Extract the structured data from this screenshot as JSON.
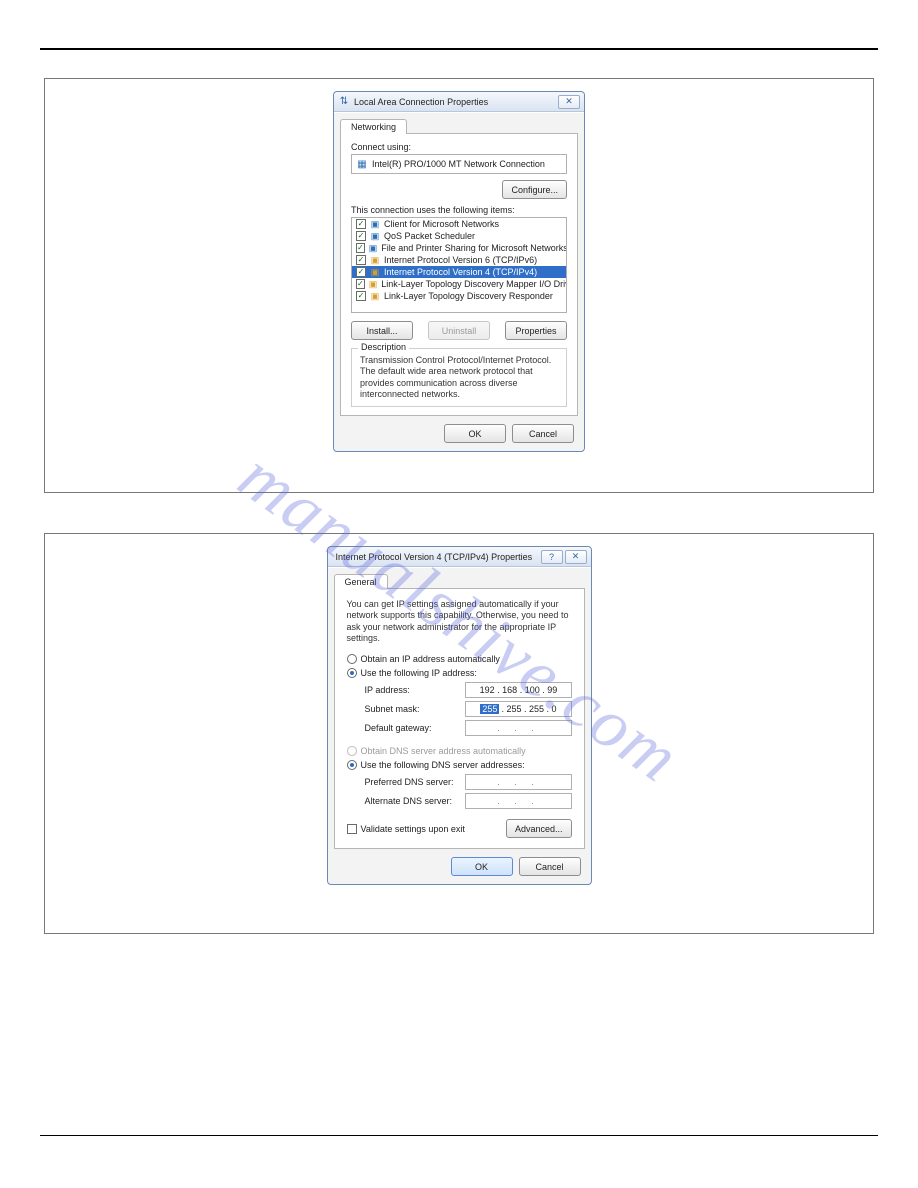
{
  "watermark": "manualshive.com",
  "dialog1": {
    "title": "Local Area Connection Properties",
    "tab": "Networking",
    "connect_using_label": "Connect using:",
    "adapter": "Intel(R) PRO/1000 MT Network Connection",
    "configure": "Configure...",
    "items_label": "This connection uses the following items:",
    "items": [
      {
        "label": "Client for Microsoft Networks",
        "selected": false,
        "iconColor": "#2b6fb5"
      },
      {
        "label": "QoS Packet Scheduler",
        "selected": false,
        "iconColor": "#2b6fb5"
      },
      {
        "label": "File and Printer Sharing for Microsoft Networks",
        "selected": false,
        "iconColor": "#2b6fb5"
      },
      {
        "label": "Internet Protocol Version 6 (TCP/IPv6)",
        "selected": false,
        "iconColor": "#d8a02a"
      },
      {
        "label": "Internet Protocol Version 4 (TCP/IPv4)",
        "selected": true,
        "iconColor": "#d8a02a"
      },
      {
        "label": "Link-Layer Topology Discovery Mapper I/O Driver",
        "selected": false,
        "iconColor": "#d8a02a"
      },
      {
        "label": "Link-Layer Topology Discovery Responder",
        "selected": false,
        "iconColor": "#d8a02a"
      }
    ],
    "install": "Install...",
    "uninstall": "Uninstall",
    "properties": "Properties",
    "desc_title": "Description",
    "desc": "Transmission Control Protocol/Internet Protocol. The default wide area network protocol that provides communication across diverse interconnected networks.",
    "ok": "OK",
    "cancel": "Cancel"
  },
  "dialog2": {
    "title": "Internet Protocol Version 4 (TCP/IPv4) Properties",
    "tab": "General",
    "blurb": "You can get IP settings assigned automatically if your network supports this capability. Otherwise, you need to ask your network administrator for the appropriate IP settings.",
    "opt_auto_ip": "Obtain an IP address automatically",
    "opt_manual_ip": "Use the following IP address:",
    "ip_label": "IP address:",
    "ip_value": "192 . 168 . 100 . 99",
    "subnet_label": "Subnet mask:",
    "subnet_sel": "255",
    "subnet_rest": " . 255 . 255 .  0",
    "gateway_label": "Default gateway:",
    "gateway_value": ".       .       .",
    "opt_auto_dns": "Obtain DNS server address automatically",
    "opt_manual_dns": "Use the following DNS server addresses:",
    "pref_dns_label": "Preferred DNS server:",
    "alt_dns_label": "Alternate DNS server:",
    "dns_blank": ".       .       .",
    "validate": "Validate settings upon exit",
    "advanced": "Advanced...",
    "ok": "OK",
    "cancel": "Cancel"
  }
}
